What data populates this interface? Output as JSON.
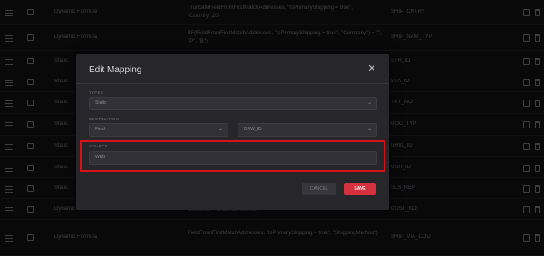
{
  "table": {
    "rows": [
      {
        "type": "Dynamic Formula",
        "source": "TruncateFieldFromFirstMatchAddresses, \"IsPrimaryShipping = true\", \"Country\",20)",
        "destination": "SHIP_CNTRY"
      },
      {
        "type": "Dynamic Formula",
        "source": "IIF(FieldFromFirstMatchAddresses, \"IsPrimaryShipping = true\", \"Company\") = \"\", \"P\", \"B\")",
        "destination": "SHIP_NAM_TYP"
      },
      {
        "type": "Static",
        "source": "",
        "destination": "STR_ID"
      },
      {
        "type": "Static",
        "source": "",
        "destination": "STA_ID"
      },
      {
        "type": "Static",
        "source": "",
        "destination": "TXT_NO"
      },
      {
        "type": "Static",
        "source": "",
        "destination": "DOC_TYP"
      },
      {
        "type": "Static",
        "source": "",
        "destination": "DRW_ID"
      },
      {
        "type": "Static",
        "source": "",
        "destination": "USR_ID"
      },
      {
        "type": "Static",
        "source": "",
        "destination": "SLS_REP"
      },
      {
        "type": "Dynamic Formula",
        "source": "CustomerFromEmailAddress",
        "destination": "CUST_NO"
      },
      {
        "type": "Dynamic Formula",
        "source": "FieldFromFirstMatchAddresses, \"IsPrimaryShipping = true\", \"ShippingMethod\")",
        "destination": "SHIP_VIA_COD"
      }
    ]
  },
  "modal": {
    "title": "Edit Mapping",
    "close_icon": "close-icon",
    "type_label": "TYPES",
    "type_value": "Static",
    "destination_label": "DESTINATION",
    "destination_table": "Field",
    "destination_field": "DRW_ID",
    "source_label": "SOURCE",
    "source_value": "WEB",
    "cancel_label": "CANCEL",
    "save_label": "SAVE"
  },
  "colors": {
    "highlight": "#d4121a",
    "save_button": "#d4303d"
  }
}
